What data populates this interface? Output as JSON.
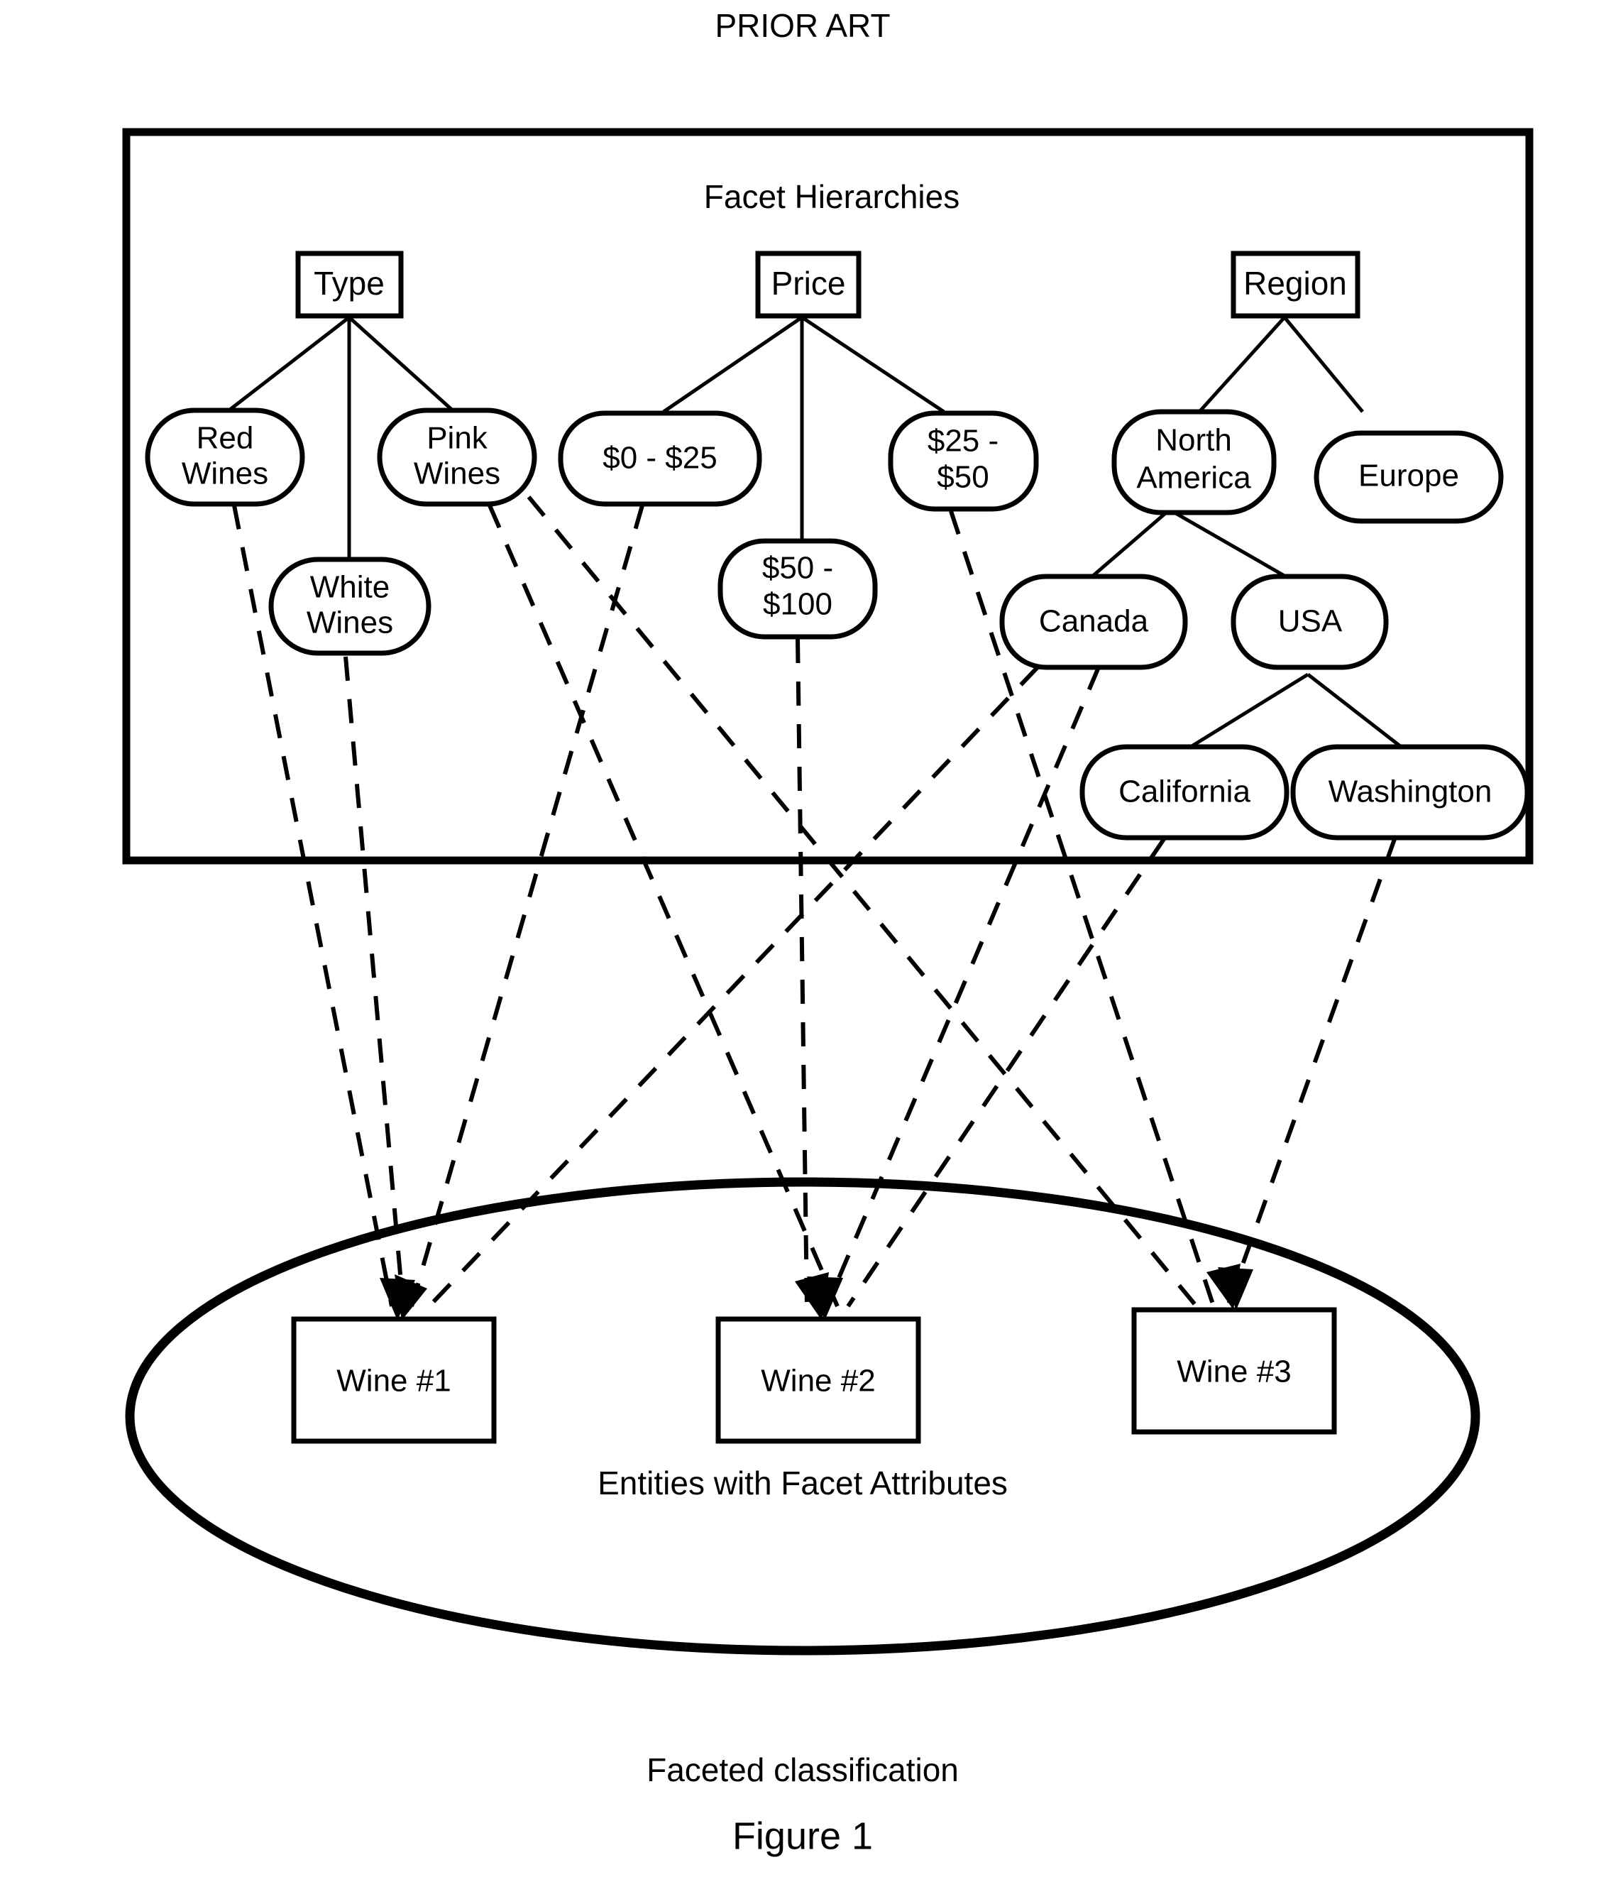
{
  "page": {
    "header": "PRIOR ART",
    "caption": "Faceted classification",
    "figure_number": "Figure 1"
  },
  "facet_panel": {
    "title": "Facet Hierarchies"
  },
  "entity_panel": {
    "title": "Entities with Facet Attributes"
  },
  "facets": {
    "type": {
      "root": "Type",
      "children": [
        {
          "label_line1": "Red",
          "label_line2": "Wines"
        },
        {
          "label_line1": "White",
          "label_line2": "Wines"
        },
        {
          "label_line1": "Pink",
          "label_line2": "Wines"
        }
      ]
    },
    "price": {
      "root": "Price",
      "children": [
        {
          "label_line1": "$0 - $25",
          "label_line2": ""
        },
        {
          "label_line1": "$50 -",
          "label_line2": "$100"
        },
        {
          "label_line1": "$25 -",
          "label_line2": "$50"
        }
      ]
    },
    "region": {
      "root": "Region",
      "children": [
        {
          "label_line1": "North",
          "label_line2": "America"
        },
        {
          "label_line1": "Europe",
          "label_line2": ""
        }
      ],
      "north_america_children": [
        {
          "label_line1": "Canada",
          "label_line2": ""
        },
        {
          "label_line1": "USA",
          "label_line2": ""
        }
      ],
      "usa_children": [
        {
          "label_line1": "California",
          "label_line2": ""
        },
        {
          "label_line1": "Washington",
          "label_line2": ""
        }
      ]
    }
  },
  "entities": [
    {
      "label": "Wine #1"
    },
    {
      "label": "Wine #2"
    },
    {
      "label": "Wine #3"
    }
  ],
  "chart_data": {
    "type": "diagram",
    "title": "Faceted classification",
    "nodes": [
      {
        "id": "type",
        "label": "Type",
        "shape": "rect",
        "level": 0,
        "facet": "Type"
      },
      {
        "id": "red",
        "label": "Red Wines",
        "shape": "rounded",
        "level": 1,
        "facet": "Type"
      },
      {
        "id": "white",
        "label": "White Wines",
        "shape": "rounded",
        "level": 1,
        "facet": "Type"
      },
      {
        "id": "pink",
        "label": "Pink Wines",
        "shape": "rounded",
        "level": 1,
        "facet": "Type"
      },
      {
        "id": "price",
        "label": "Price",
        "shape": "rect",
        "level": 0,
        "facet": "Price"
      },
      {
        "id": "p0_25",
        "label": "$0 - $25",
        "shape": "rounded",
        "level": 1,
        "facet": "Price"
      },
      {
        "id": "p50_100",
        "label": "$50 - $100",
        "shape": "rounded",
        "level": 1,
        "facet": "Price"
      },
      {
        "id": "p25_50",
        "label": "$25 - $50",
        "shape": "rounded",
        "level": 1,
        "facet": "Price"
      },
      {
        "id": "region",
        "label": "Region",
        "shape": "rect",
        "level": 0,
        "facet": "Region"
      },
      {
        "id": "na",
        "label": "North America",
        "shape": "rounded",
        "level": 1,
        "facet": "Region"
      },
      {
        "id": "europe",
        "label": "Europe",
        "shape": "rounded",
        "level": 1,
        "facet": "Region"
      },
      {
        "id": "canada",
        "label": "Canada",
        "shape": "rounded",
        "level": 2,
        "facet": "Region"
      },
      {
        "id": "usa",
        "label": "USA",
        "shape": "rounded",
        "level": 2,
        "facet": "Region"
      },
      {
        "id": "california",
        "label": "California",
        "shape": "rounded",
        "level": 3,
        "facet": "Region"
      },
      {
        "id": "washington",
        "label": "Washington",
        "shape": "rounded",
        "level": 3,
        "facet": "Region"
      },
      {
        "id": "wine1",
        "label": "Wine #1",
        "shape": "rect",
        "group": "entities"
      },
      {
        "id": "wine2",
        "label": "Wine #2",
        "shape": "rect",
        "group": "entities"
      },
      {
        "id": "wine3",
        "label": "Wine #3",
        "shape": "rect",
        "group": "entities"
      }
    ],
    "hierarchy_edges": [
      [
        "type",
        "red"
      ],
      [
        "type",
        "white"
      ],
      [
        "type",
        "pink"
      ],
      [
        "price",
        "p0_25"
      ],
      [
        "price",
        "p50_100"
      ],
      [
        "price",
        "p25_50"
      ],
      [
        "region",
        "na"
      ],
      [
        "region",
        "europe"
      ],
      [
        "na",
        "canada"
      ],
      [
        "na",
        "usa"
      ],
      [
        "usa",
        "california"
      ],
      [
        "usa",
        "washington"
      ]
    ],
    "attribute_edges": [
      [
        "red",
        "wine1"
      ],
      [
        "pink",
        "wine2"
      ],
      [
        "p0_25",
        "wine1"
      ],
      [
        "p50_100",
        "wine2"
      ],
      [
        "p25_50",
        "wine3"
      ],
      [
        "canada",
        "wine1"
      ],
      [
        "california",
        "wine2"
      ],
      [
        "washington",
        "wine3"
      ],
      [
        "pink",
        "wine3"
      ],
      [
        "red",
        "wine2"
      ]
    ],
    "containers": [
      {
        "id": "facet-panel",
        "label": "Facet Hierarchies",
        "shape": "rectangle"
      },
      {
        "id": "entity-panel",
        "label": "Entities with Facet Attributes",
        "shape": "ellipse"
      }
    ]
  }
}
